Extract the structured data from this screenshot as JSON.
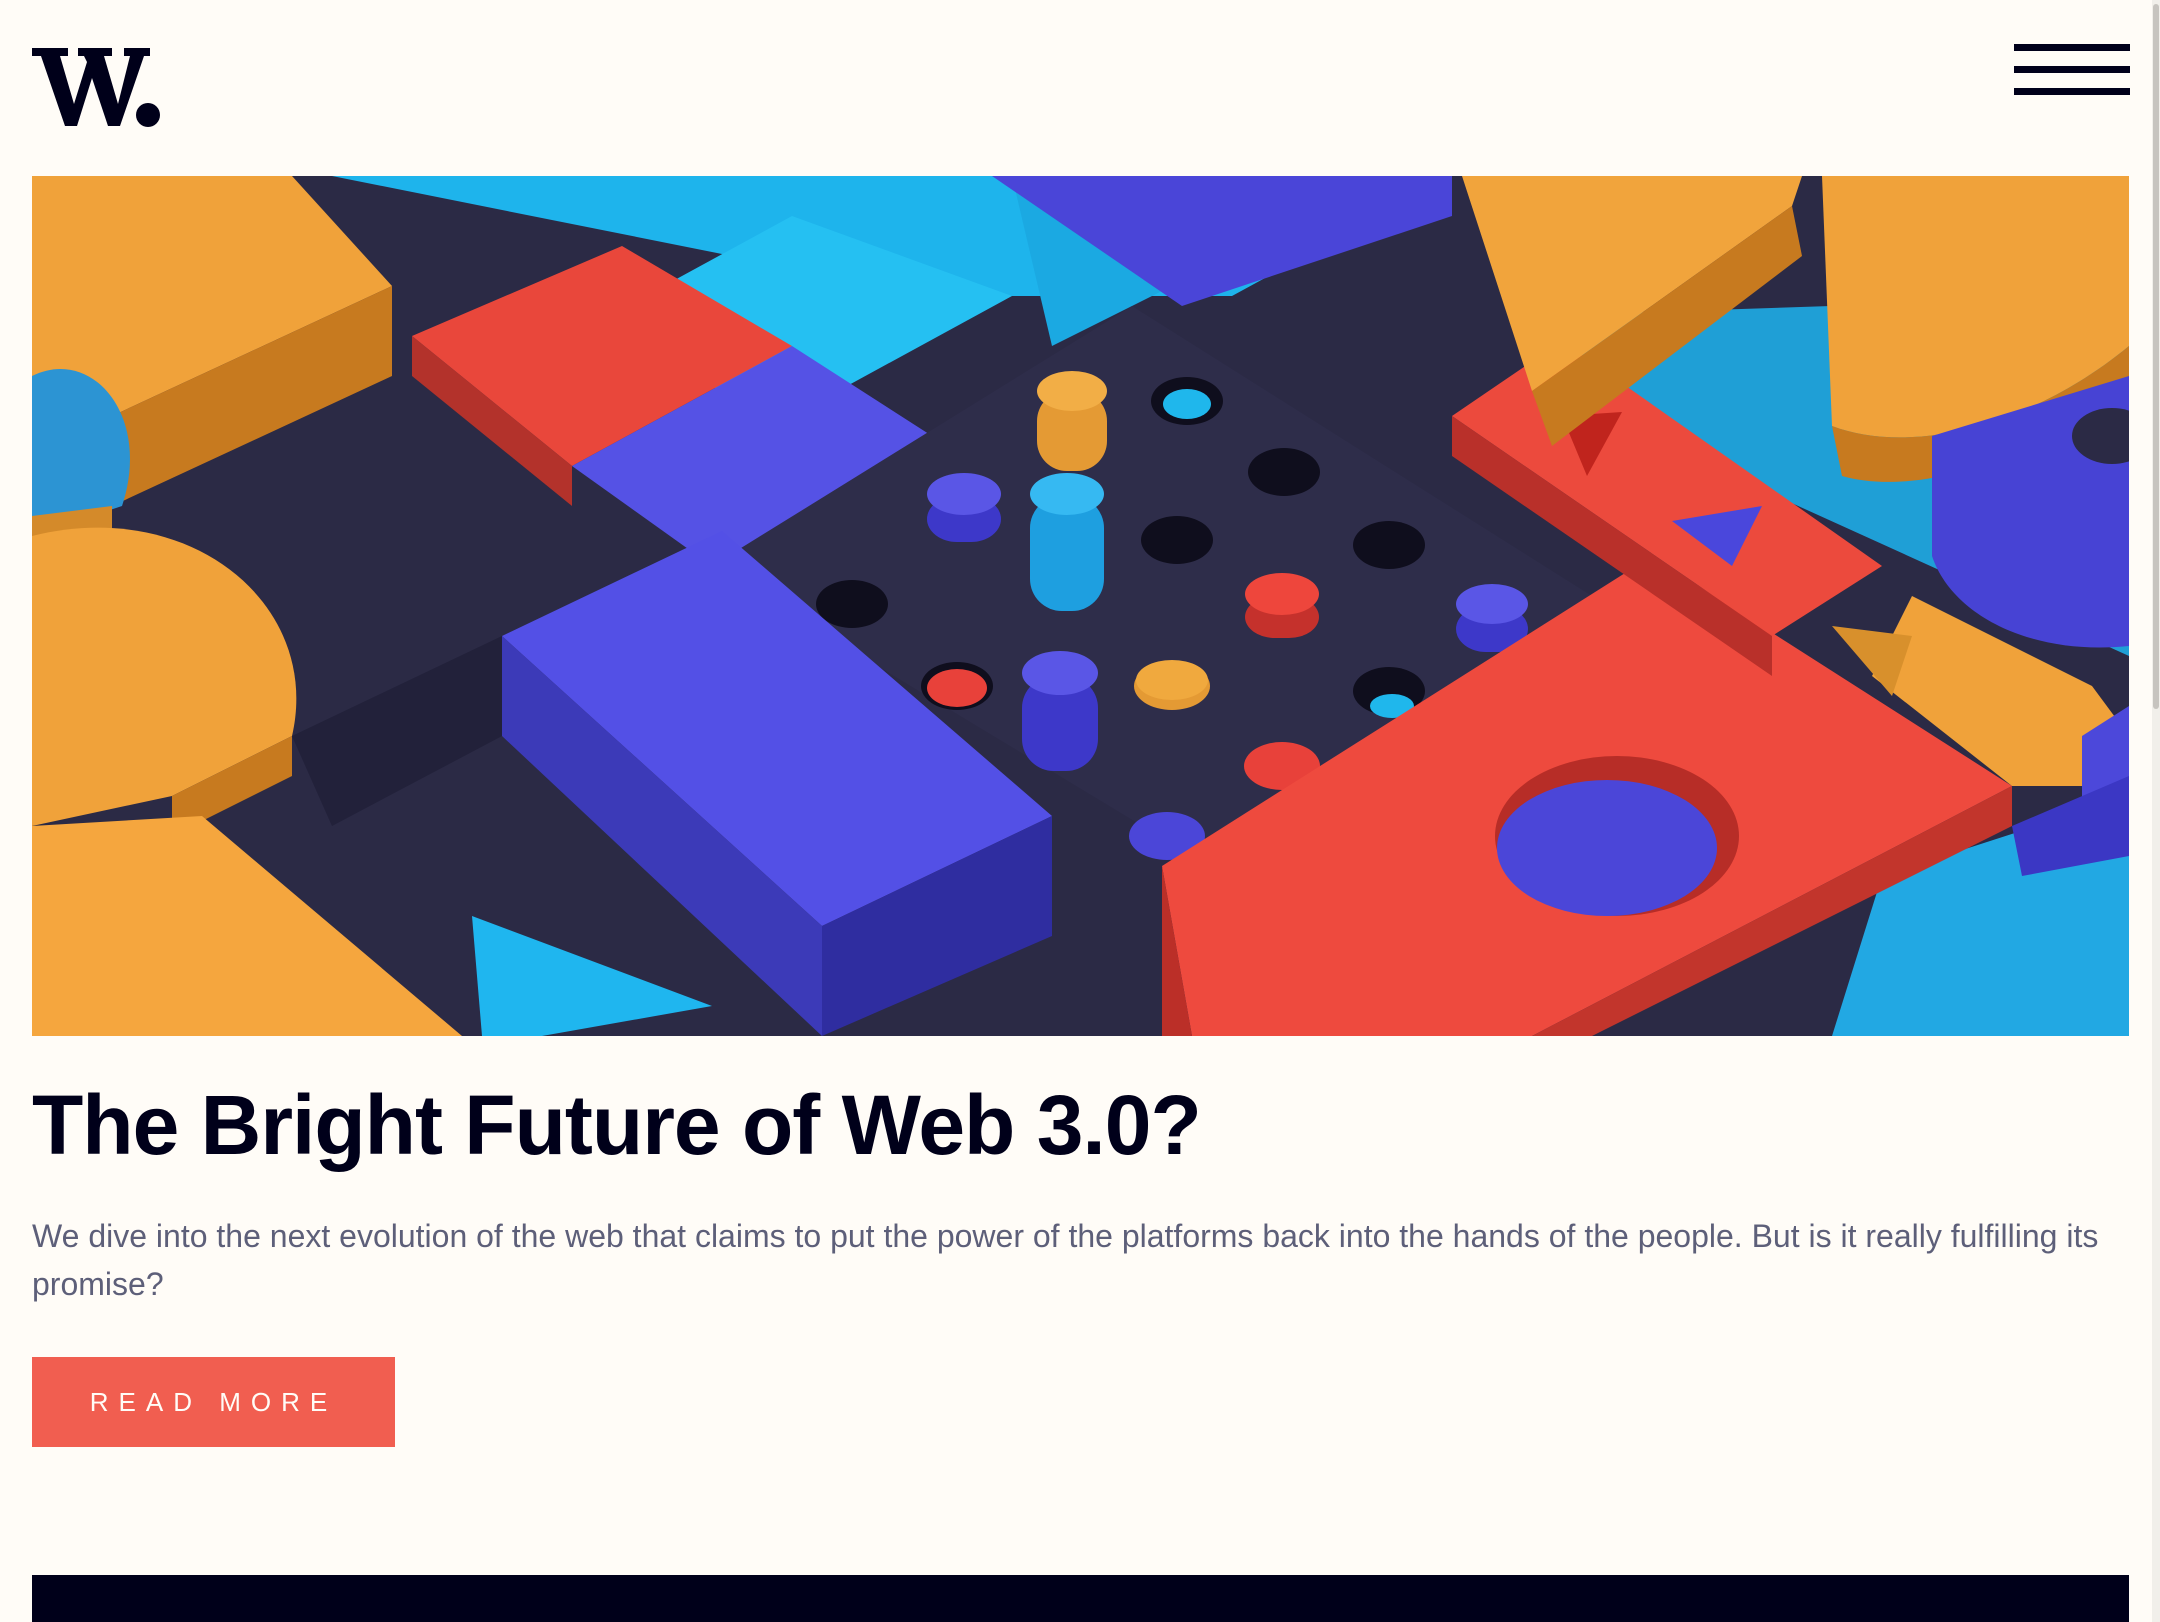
{
  "header": {
    "logo_text": "W.",
    "menu_icon": "hamburger-icon"
  },
  "hero_image": {
    "description_icon": "abstract-3d-blocks-illustration"
  },
  "article": {
    "title": "The Bright Future of Web 3.0?",
    "description": "We dive into the next evolution of the web that claims to put the power of the platforms back into the hands of the people. But is it really fulfilling its promise?",
    "read_more_label": "READ MORE"
  },
  "colors": {
    "background": "#fffcf7",
    "text_dark": "#00001a",
    "text_muted": "#5d5f79",
    "accent": "#f15e50"
  }
}
